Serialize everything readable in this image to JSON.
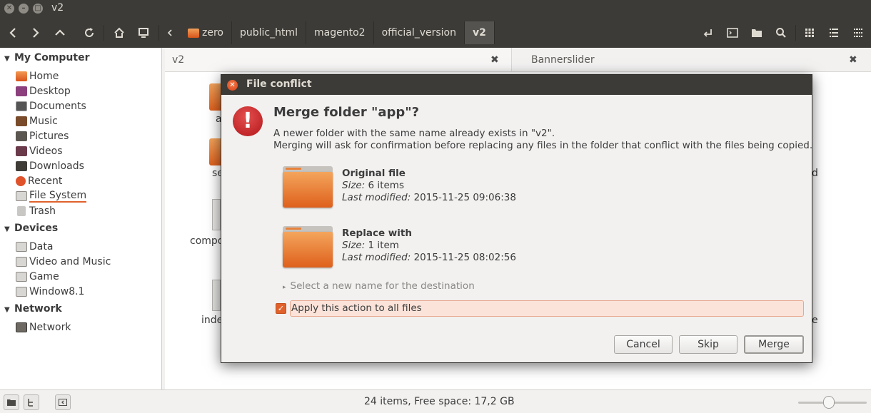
{
  "window": {
    "title": "v2"
  },
  "toolbar": {
    "path": [
      "zero",
      "public_html",
      "magento2",
      "official_version",
      "v2"
    ],
    "back_icon": "chevron-left-icon",
    "forward_icon": "chevron-right-icon"
  },
  "sidebar": {
    "sections": [
      {
        "label": "My Computer",
        "items": [
          "Home",
          "Desktop",
          "Documents",
          "Music",
          "Pictures",
          "Videos",
          "Downloads",
          "Recent",
          "File System",
          "Trash"
        ]
      },
      {
        "label": "Devices",
        "items": [
          "Data",
          "Video and Music",
          "Game",
          "Window8.1"
        ]
      },
      {
        "label": "Network",
        "items": [
          "Network"
        ]
      }
    ]
  },
  "tabs": [
    {
      "label": "v2"
    },
    {
      "label": "Bannerslider"
    }
  ],
  "background_items": {
    "a": "a",
    "se": "se",
    "compo": "compo",
    "inde": "inde",
    "d": "d",
    "e": "e"
  },
  "dialog": {
    "title": "File conflict",
    "heading": "Merge folder \"app\"?",
    "line1": "A newer folder with the same name already exists in \"v2\".",
    "line2": "Merging will ask for confirmation before replacing any files in the folder that conflict with the files being copied.",
    "original": {
      "label": "Original file",
      "size_label": "Size:",
      "size": " 6 items",
      "modified_label": "Last modified:",
      "modified": " 2015-11-25 09:06:38"
    },
    "replace": {
      "label": "Replace with",
      "size_label": "Size:",
      "size": " 1 item",
      "modified_label": "Last modified:",
      "modified": " 2015-11-25 08:02:56"
    },
    "rename_expander": "Select a new name for the destination",
    "apply_all": "Apply this action to all files",
    "apply_all_checked": true,
    "buttons": {
      "cancel": "Cancel",
      "skip": "Skip",
      "merge": "Merge"
    }
  },
  "status": {
    "text": "24 items, Free space: 17,2 GB",
    "zoom_level": 0.45
  }
}
